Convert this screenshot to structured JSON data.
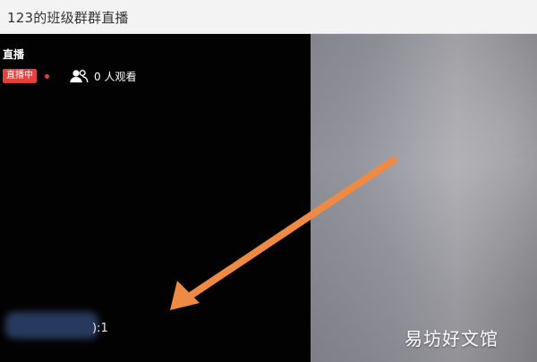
{
  "window": {
    "title": "123的班级群群直播"
  },
  "live": {
    "header": "直播",
    "badge": "直播中",
    "viewer_text": "0 人观看"
  },
  "participant": {
    "count_label": "):1"
  },
  "watermark": {
    "text": "易坊好文馆"
  },
  "colors": {
    "live_badge": "#e1433c",
    "arrow": "#ef8a45",
    "left_pane_bg": "#020202"
  },
  "icons": {
    "viewer": "people-icon"
  }
}
